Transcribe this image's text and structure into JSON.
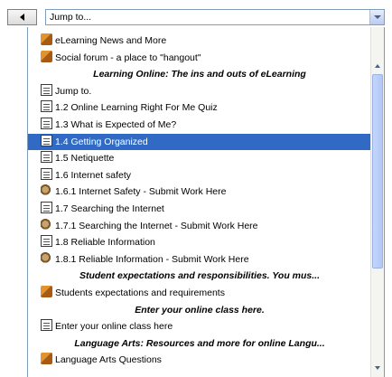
{
  "nav": {
    "back_icon": "left-arrow-icon"
  },
  "jump": {
    "value": "Jump to..."
  },
  "items": [
    {
      "type": "item",
      "icon": "forum",
      "label": "eLearning News and More"
    },
    {
      "type": "item",
      "icon": "forum",
      "label": "Social forum - a place to \"hangout\""
    },
    {
      "type": "header",
      "label": "Learning Online: The ins and outs of eLearning"
    },
    {
      "type": "item",
      "icon": "page",
      "label": "Jump to."
    },
    {
      "type": "item",
      "icon": "page",
      "label": "1.2 Online Learning Right For Me Quiz"
    },
    {
      "type": "item",
      "icon": "page",
      "label": "1.3 What is Expected of Me?"
    },
    {
      "type": "item",
      "icon": "page",
      "label": "1.4 Getting Organized",
      "selected": true
    },
    {
      "type": "item",
      "icon": "page",
      "label": "1.5 Netiquette"
    },
    {
      "type": "item",
      "icon": "page",
      "label": "1.6 Internet safety"
    },
    {
      "type": "item",
      "icon": "assign",
      "label": "1.6.1 Internet Safety - Submit Work Here"
    },
    {
      "type": "item",
      "icon": "page",
      "label": "1.7 Searching the Internet"
    },
    {
      "type": "item",
      "icon": "assign",
      "label": "1.7.1 Searching the Internet - Submit Work Here"
    },
    {
      "type": "item",
      "icon": "page",
      "label": "1.8 Reliable Information"
    },
    {
      "type": "item",
      "icon": "assign",
      "label": "1.8.1 Reliable Information - Submit Work Here"
    },
    {
      "type": "header",
      "label": "Student expectations and responsibilities. You mus..."
    },
    {
      "type": "item",
      "icon": "forum",
      "label": "Students expectations and requirements"
    },
    {
      "type": "header",
      "label": "Enter your online class here."
    },
    {
      "type": "item",
      "icon": "page",
      "label": "Enter your online class here"
    },
    {
      "type": "header",
      "label": "Language Arts: Resources and more for online Langu..."
    },
    {
      "type": "item",
      "icon": "forum",
      "label": "Language Arts Questions"
    }
  ]
}
